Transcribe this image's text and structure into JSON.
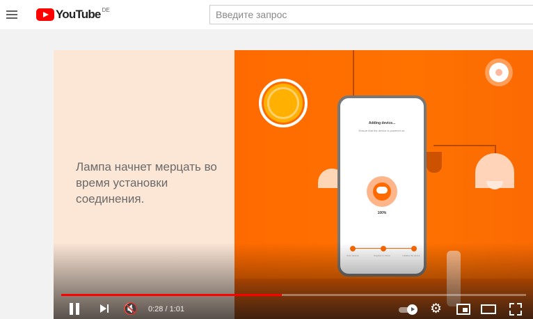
{
  "header": {
    "logo_text": "YouTube",
    "country_code": "DE",
    "search_placeholder": "Введите запрос"
  },
  "video": {
    "caption": "Лампа начнет мерцать во время установки соединения.",
    "phone_screen": {
      "title": "Adding device...",
      "subtitle": "Ensure that the device is powered on.",
      "progress_label": "100%",
      "steps": [
        "Scan devices",
        "Register to Cloud",
        "Initialize the device"
      ]
    },
    "progress_fraction": 0.475
  },
  "controls": {
    "current_time": "0:28",
    "duration": "1:01",
    "time_display": "0:28 / 1:01"
  },
  "colors": {
    "brand_red": "#ff0000",
    "video_orange": "#ff6a00",
    "panel_cream": "#fce6d6"
  }
}
